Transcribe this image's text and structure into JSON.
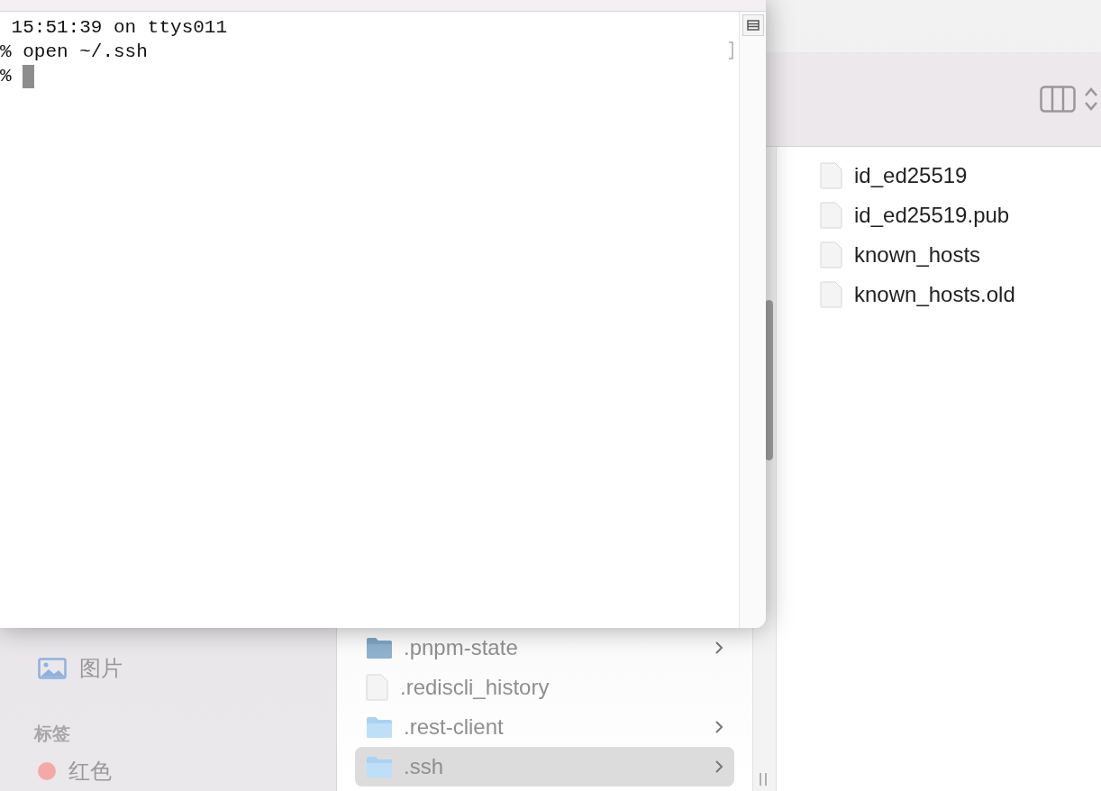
{
  "terminal": {
    "lines": [
      {
        "text": " 15:51:39 on ttys011",
        "cursor": false,
        "marked": false
      },
      {
        "text": "% open ~/.ssh",
        "cursor": false,
        "marked": true
      },
      {
        "text": "% ",
        "cursor": true,
        "marked": false
      }
    ]
  },
  "finder": {
    "sidebar": {
      "items": [
        {
          "kind": "item",
          "label": "图片"
        },
        {
          "kind": "header",
          "label": "标签"
        },
        {
          "kind": "tag",
          "label": "红色",
          "color": "#f4a9a9"
        }
      ]
    },
    "columns": [
      {
        "items": [
          {
            "name": ".pnpm-state",
            "kind": "folder",
            "selected": false
          },
          {
            "name": ".rediscli_history",
            "kind": "file",
            "selected": false
          },
          {
            "name": ".rest-client",
            "kind": "folder",
            "selected": false
          },
          {
            "name": ".ssh",
            "kind": "folder",
            "selected": true
          }
        ]
      },
      {
        "items": [
          {
            "name": "id_ed25519",
            "kind": "file",
            "selected": false
          },
          {
            "name": "id_ed25519.pub",
            "kind": "file",
            "selected": false
          },
          {
            "name": "known_hosts",
            "kind": "file",
            "selected": false
          },
          {
            "name": "known_hosts.old",
            "kind": "file",
            "selected": false
          }
        ]
      }
    ]
  }
}
